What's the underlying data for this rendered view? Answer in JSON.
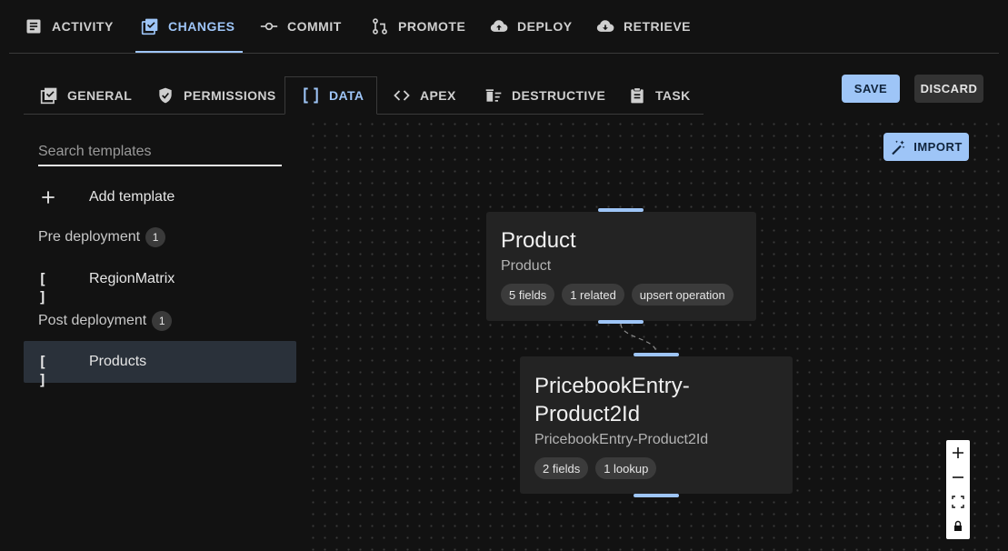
{
  "topnav": {
    "tabs": [
      {
        "label": "ACTIVITY",
        "icon": "activity-icon"
      },
      {
        "label": "CHANGES",
        "icon": "changes-icon",
        "active": true
      },
      {
        "label": "COMMIT",
        "icon": "commit-icon"
      },
      {
        "label": "PROMOTE",
        "icon": "promote-icon"
      },
      {
        "label": "DEPLOY",
        "icon": "cloud-upload-icon"
      },
      {
        "label": "RETRIEVE",
        "icon": "cloud-download-icon"
      }
    ]
  },
  "subtabs": {
    "tabs": [
      {
        "label": "GENERAL",
        "icon": "checklist-icon"
      },
      {
        "label": "PERMISSIONS",
        "icon": "shield-check-icon"
      },
      {
        "label": "DATA",
        "icon": "brackets-icon",
        "active": true
      },
      {
        "label": "APEX",
        "icon": "code-icon"
      },
      {
        "label": "DESTRUCTIVE",
        "icon": "delete-sweep-icon"
      },
      {
        "label": "TASK",
        "icon": "clipboard-icon"
      }
    ]
  },
  "actions": {
    "save": "SAVE",
    "discard": "DISCARD",
    "import": "IMPORT"
  },
  "sidebar": {
    "search_placeholder": "Search templates",
    "add_template": "Add template",
    "pre_deployment": {
      "label": "Pre deployment",
      "count": "1",
      "items": [
        "RegionMatrix"
      ]
    },
    "post_deployment": {
      "label": "Post deployment",
      "count": "1",
      "items": [
        "Products"
      ]
    },
    "bracket_glyph": "[ ]"
  },
  "canvas": {
    "nodes": [
      {
        "title": "Product",
        "subtitle": "Product",
        "chips": [
          "5 fields",
          "1 related",
          "upsert operation"
        ]
      },
      {
        "title_line1": "PricebookEntry-",
        "title_line2": "Product2Id",
        "subtitle": "PricebookEntry-Product2Id",
        "chips": [
          "2 fields",
          "1 lookup"
        ]
      }
    ],
    "controls": [
      "zoom-in-icon",
      "zoom-out-icon",
      "fit-view-icon",
      "lock-icon"
    ]
  },
  "colors": {
    "accent": "#9ec5f7",
    "background": "#121212",
    "node": "#232323",
    "selected": "#2a313a"
  }
}
